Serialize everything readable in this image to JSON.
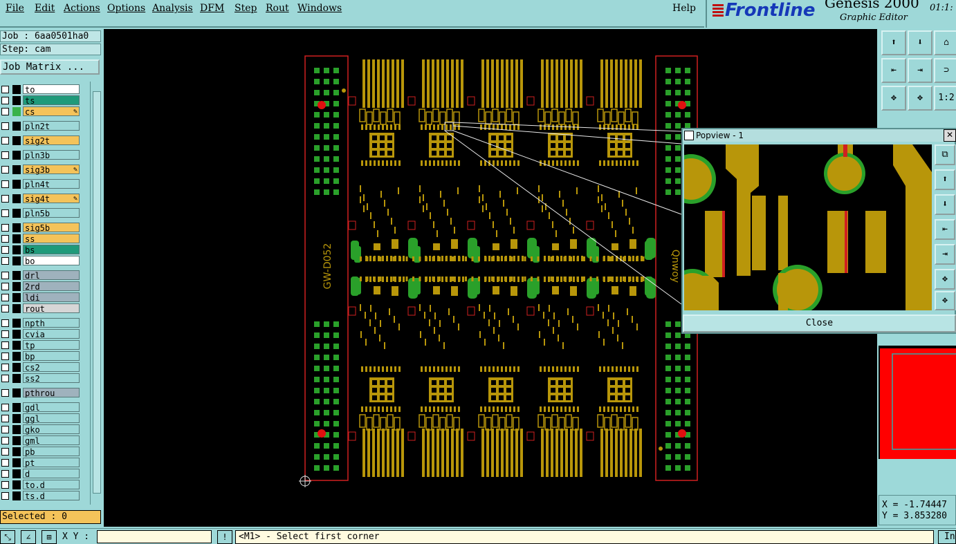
{
  "menu": {
    "items": [
      "File",
      "Edit",
      "Actions",
      "Options",
      "Analysis",
      "DFM",
      "Step",
      "Rout",
      "Windows"
    ],
    "help": "Help"
  },
  "brand": {
    "logo": "Frontline",
    "product": "Genesis 2000",
    "subtitle": "Graphic Editor",
    "clock": "01:1:"
  },
  "left": {
    "job": "Job : 6aa0501ha0",
    "step": "Step: cam",
    "job_matrix": "Job Matrix ...",
    "layers": [
      {
        "name": "to",
        "bg": "#ffffff",
        "sw": "#000000",
        "mark": ""
      },
      {
        "name": "ts",
        "bg": "#1f9a7a",
        "sw": "#000000",
        "mark": ""
      },
      {
        "name": "cs",
        "bg": "#f4c35a",
        "sw": "#39b24a",
        "mark": "✎"
      },
      {
        "name": "pln2t",
        "bg": "#9ed8d8",
        "sw": "#000000",
        "mark": ""
      },
      {
        "name": "sig2t",
        "bg": "#f4c35a",
        "sw": "#000000",
        "mark": ""
      },
      {
        "name": "pln3b",
        "bg": "#9ed8d8",
        "sw": "#000000",
        "mark": ""
      },
      {
        "name": "sig3b",
        "bg": "#f4c35a",
        "sw": "#000000",
        "mark": "✎"
      },
      {
        "name": "pln4t",
        "bg": "#9ed8d8",
        "sw": "#000000",
        "mark": ""
      },
      {
        "name": "sig4t",
        "bg": "#f4c35a",
        "sw": "#000000",
        "mark": "✎"
      },
      {
        "name": "pln5b",
        "bg": "#9ed8d8",
        "sw": "#000000",
        "mark": ""
      },
      {
        "name": "sig5b",
        "bg": "#f4c35a",
        "sw": "#000000",
        "mark": ""
      },
      {
        "name": "ss",
        "bg": "#f4c35a",
        "sw": "#000000",
        "mark": ""
      },
      {
        "name": "bs",
        "bg": "#1f9a7a",
        "sw": "#000000",
        "mark": ""
      },
      {
        "name": "bo",
        "bg": "#ffffff",
        "sw": "#000000",
        "mark": ""
      },
      {
        "name": "drl",
        "bg": "#9fb2bd",
        "sw": "#000000",
        "mark": ""
      },
      {
        "name": "2rd",
        "bg": "#9fb2bd",
        "sw": "#000000",
        "mark": ""
      },
      {
        "name": "ldi",
        "bg": "#9fb2bd",
        "sw": "#000000",
        "mark": ""
      },
      {
        "name": "rout",
        "bg": "#d6d6d6",
        "sw": "#000000",
        "mark": ""
      },
      {
        "name": "npth",
        "bg": "#9ed8d8",
        "sw": "#000000",
        "mark": ""
      },
      {
        "name": "cvia",
        "bg": "#9ed8d8",
        "sw": "#000000",
        "mark": ""
      },
      {
        "name": "tp",
        "bg": "#9ed8d8",
        "sw": "#000000",
        "mark": ""
      },
      {
        "name": "bp",
        "bg": "#9ed8d8",
        "sw": "#000000",
        "mark": ""
      },
      {
        "name": "cs2",
        "bg": "#9ed8d8",
        "sw": "#000000",
        "mark": ""
      },
      {
        "name": "ss2",
        "bg": "#9ed8d8",
        "sw": "#000000",
        "mark": ""
      },
      {
        "name": "pthrou",
        "bg": "#9fb2bd",
        "sw": "#000000",
        "mark": ""
      },
      {
        "name": "gdl",
        "bg": "#9ed8d8",
        "sw": "#000000",
        "mark": ""
      },
      {
        "name": "ggl",
        "bg": "#9ed8d8",
        "sw": "#000000",
        "mark": ""
      },
      {
        "name": "gko",
        "bg": "#9ed8d8",
        "sw": "#000000",
        "mark": ""
      },
      {
        "name": "gml",
        "bg": "#9ed8d8",
        "sw": "#000000",
        "mark": ""
      },
      {
        "name": "pb",
        "bg": "#9ed8d8",
        "sw": "#000000",
        "mark": ""
      },
      {
        "name": "pt",
        "bg": "#9ed8d8",
        "sw": "#000000",
        "mark": ""
      },
      {
        "name": "d",
        "bg": "#9ed8d8",
        "sw": "#000000",
        "mark": ""
      },
      {
        "name": "to.d",
        "bg": "#9ed8d8",
        "sw": "#000000",
        "mark": ""
      },
      {
        "name": "ts.d",
        "bg": "#9ed8d8",
        "sw": "#000000",
        "mark": ""
      }
    ],
    "selected": "Selected : 0"
  },
  "canvas": {
    "left_rail_text": "GW-D052",
    "right_rail_text": "Qnwoy"
  },
  "popview": {
    "title": "Popview - 1",
    "close": "Close"
  },
  "right_tools": [
    "⬆",
    "⬇",
    "⌂",
    "⇤",
    "⇥",
    "⊃",
    "✥",
    "✥",
    "1:2"
  ],
  "coords": {
    "x": "X = -1.74447",
    "y": "Y = 3.853280"
  },
  "status": {
    "xy_label": "X Y :",
    "prompt": "<M1> - Select first corner",
    "info_btn": "In"
  },
  "colors": {
    "copper": "#b8960a",
    "mask": "#2aa02a",
    "outline": "#d02020"
  }
}
